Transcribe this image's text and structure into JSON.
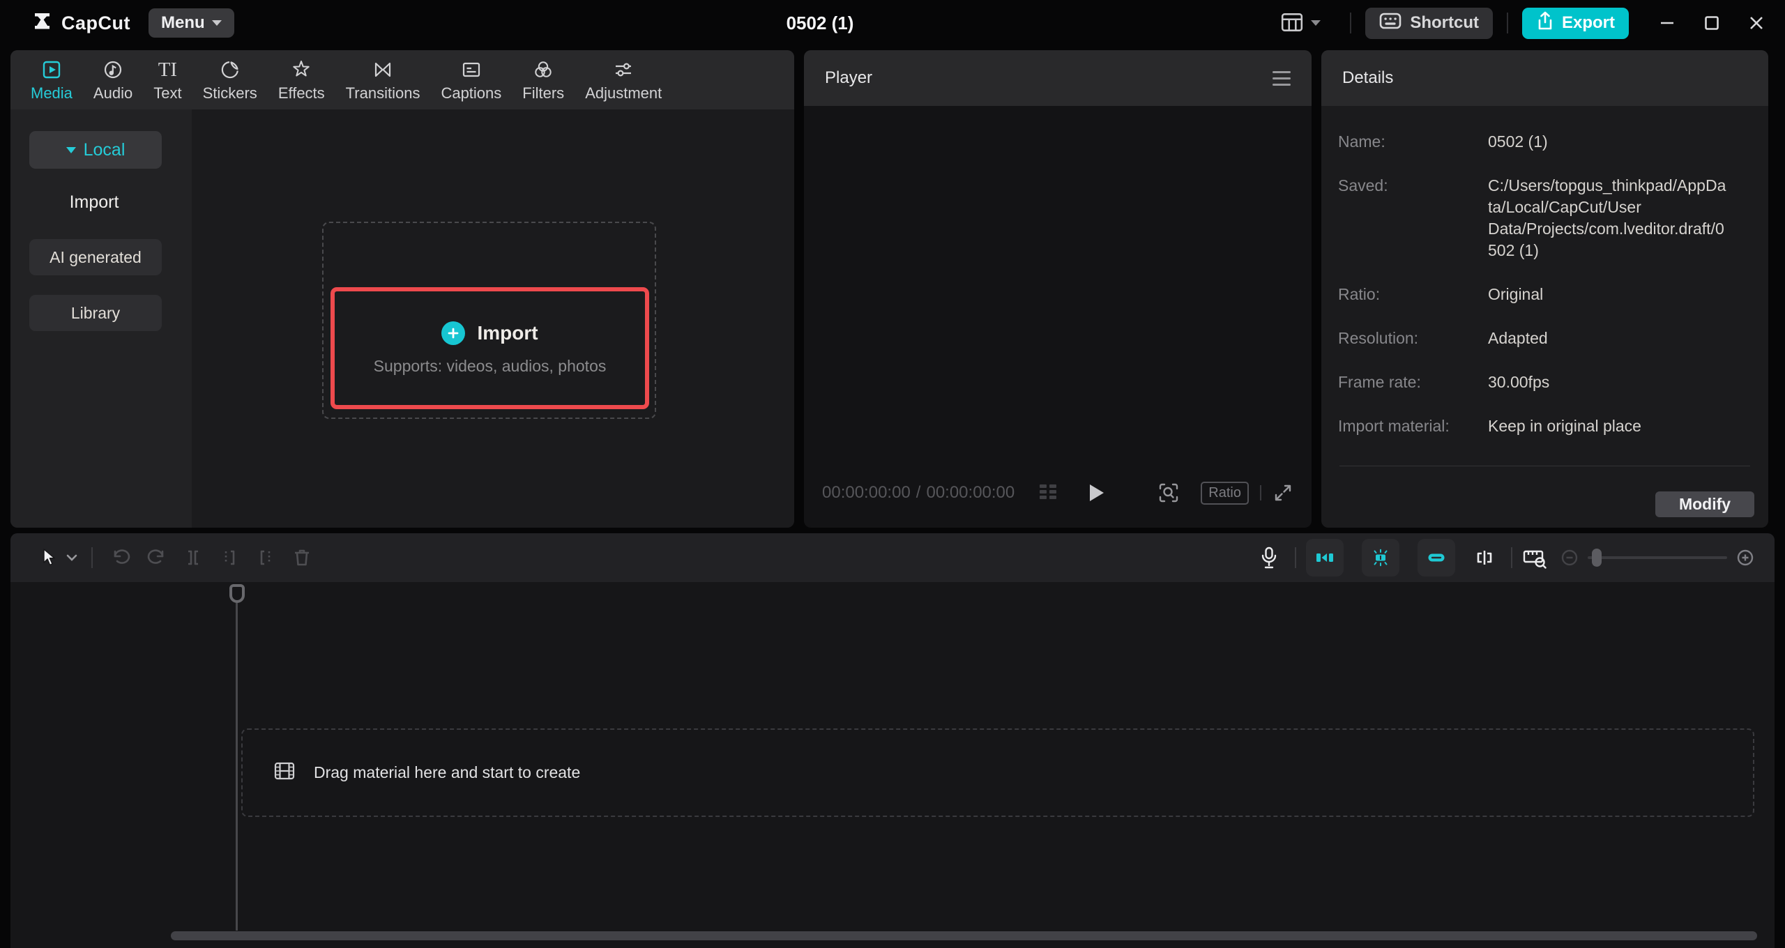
{
  "titlebar": {
    "app_name": "CapCut",
    "menu_label": "Menu",
    "project_title": "0502 (1)",
    "shortcut_label": "Shortcut",
    "export_label": "Export"
  },
  "media_panel": {
    "tabs": [
      {
        "label": "Media",
        "active": true
      },
      {
        "label": "Audio"
      },
      {
        "label": "Text"
      },
      {
        "label": "Stickers"
      },
      {
        "label": "Effects"
      },
      {
        "label": "Transitions"
      },
      {
        "label": "Captions"
      },
      {
        "label": "Filters"
      },
      {
        "label": "Adjustment"
      }
    ],
    "text_tab_glyph": "TI",
    "sidebar": {
      "local_label": "Local",
      "import_label": "Import",
      "ai_generated_label": "AI generated",
      "library_label": "Library"
    },
    "import_area": {
      "title": "Import",
      "subtitle": "Supports: videos, audios, photos"
    }
  },
  "player": {
    "title": "Player",
    "current_time": "00:00:00:00",
    "time_separator": "/",
    "total_time": "00:00:00:00",
    "ratio_label": "Ratio"
  },
  "details": {
    "title": "Details",
    "rows": [
      {
        "label": "Name:",
        "value": "0502 (1)"
      },
      {
        "label": "Saved:",
        "value": "C:/Users/topgus_thinkpad/AppData/Local/CapCut/User Data/Projects/com.lveditor.draft/0502 (1)"
      },
      {
        "label": "Ratio:",
        "value": "Original"
      },
      {
        "label": "Resolution:",
        "value": "Adapted"
      },
      {
        "label": "Frame rate:",
        "value": "30.00fps"
      },
      {
        "label": "Import material:",
        "value": "Keep in original place"
      }
    ],
    "modify_label": "Modify"
  },
  "timeline": {
    "empty_text": "Drag material here and start to create"
  },
  "colors": {
    "accent_teal": "#26ccd8",
    "export_button": "#00c3cb",
    "annotation_red": "#ee4a4d",
    "panel_header": "#29292b",
    "panel_body": "#1b1b1d"
  }
}
